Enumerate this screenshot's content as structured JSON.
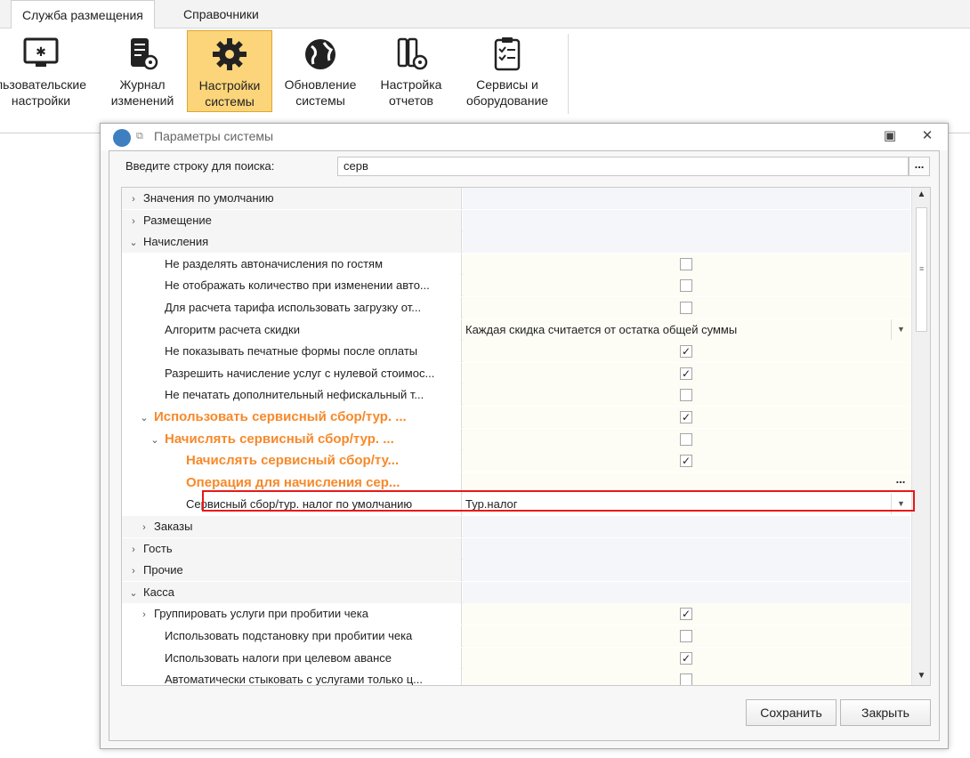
{
  "menu": {
    "items": [
      "Служба размещения",
      "Справочники"
    ]
  },
  "ribbon": {
    "buttons": [
      {
        "label": "льзовательские\nнастройки",
        "icon": "monitor-settings-icon"
      },
      {
        "label": "Журнал\nизменений",
        "icon": "journal-gear-icon"
      },
      {
        "label": "Настройки\nсистемы",
        "icon": "gear-icon",
        "selected": true
      },
      {
        "label": "Обновление\nсистемы",
        "icon": "globe-icon"
      },
      {
        "label": "Настройка\nотчетов",
        "icon": "report-binders-gear-icon"
      },
      {
        "label": "Сервисы и\nоборудование",
        "icon": "clipboard-checklist-icon"
      }
    ]
  },
  "dialog": {
    "title": "Параметры системы",
    "search_label": "Введите строку для поиска:",
    "search_value": "серв",
    "search_more": "...",
    "save_button": "Сохранить",
    "close_button": "Закрыть"
  },
  "grid": {
    "rows": [
      {
        "label": "Значения по умолчанию",
        "level": 0,
        "expander": "›",
        "type": "category"
      },
      {
        "label": "Размещение",
        "level": 0,
        "expander": "›",
        "type": "category"
      },
      {
        "label": "Начисления",
        "level": 0,
        "expander": "⌄",
        "type": "category"
      },
      {
        "label": "Не разделять автоначисления по гостям",
        "level": 2,
        "type": "checkbox",
        "checked": false
      },
      {
        "label": "Не отображать количество при изменении авто...",
        "level": 2,
        "type": "checkbox",
        "checked": false
      },
      {
        "label": "Для расчета тарифа использовать загрузку от...",
        "level": 2,
        "type": "checkbox",
        "checked": false
      },
      {
        "label": "Алгоритм расчета скидки",
        "level": 2,
        "type": "dropdown",
        "value": "Каждая скидка считается от остатка общей суммы"
      },
      {
        "label": "Не показывать печатные формы после оплаты",
        "level": 2,
        "type": "checkbox",
        "checked": true
      },
      {
        "label": "Разрешить начисление услуг с нулевой стоимос...",
        "level": 2,
        "type": "checkbox",
        "checked": true
      },
      {
        "label": "Не печатать дополнительный нефискальный т...",
        "level": 2,
        "type": "checkbox",
        "checked": false
      },
      {
        "label": "Использовать сервисный сбор/тур. ...",
        "level": 1,
        "expander": "⌄",
        "type": "checkbox",
        "checked": true,
        "highlight": true
      },
      {
        "label": "Начислять сервисный сбор/тур. ...",
        "level": 2,
        "expander": "⌄",
        "type": "checkbox",
        "checked": false,
        "highlight": true
      },
      {
        "label": "Начислять сервисный сбор/ту...",
        "level": 4,
        "type": "checkbox",
        "checked": true,
        "highlight": true
      },
      {
        "label": "Операция для начисления сер...",
        "level": 4,
        "type": "ellipsis",
        "highlight": true
      },
      {
        "label": "Сервисный сбор/тур. налог по умолчанию",
        "level": 4,
        "type": "dropdown",
        "value": "Тур.налог",
        "selected": true
      },
      {
        "label": "Заказы",
        "level": 1,
        "expander": "›",
        "type": "category"
      },
      {
        "label": "Гость",
        "level": 0,
        "expander": "›",
        "type": "category"
      },
      {
        "label": "Прочие",
        "level": 0,
        "expander": "›",
        "type": "category"
      },
      {
        "label": "Касса",
        "level": 0,
        "expander": "⌄",
        "type": "category"
      },
      {
        "label": "Группировать услуги при пробитии чека",
        "level": 1,
        "expander": "›",
        "type": "checkbox",
        "checked": true
      },
      {
        "label": "Использовать подстановку при пробитии чека",
        "level": 2,
        "type": "checkbox",
        "checked": false
      },
      {
        "label": "Использовать налоги при целевом авансе",
        "level": 2,
        "type": "checkbox",
        "checked": true
      },
      {
        "label": "Автоматически стыковать с услугами только ц...",
        "level": 2,
        "type": "checkbox",
        "checked": false
      }
    ]
  },
  "colors": {
    "accent_orange": "#f7892a",
    "selected_ribbon": "#fcd57a",
    "highlight_box": "#e81818"
  }
}
